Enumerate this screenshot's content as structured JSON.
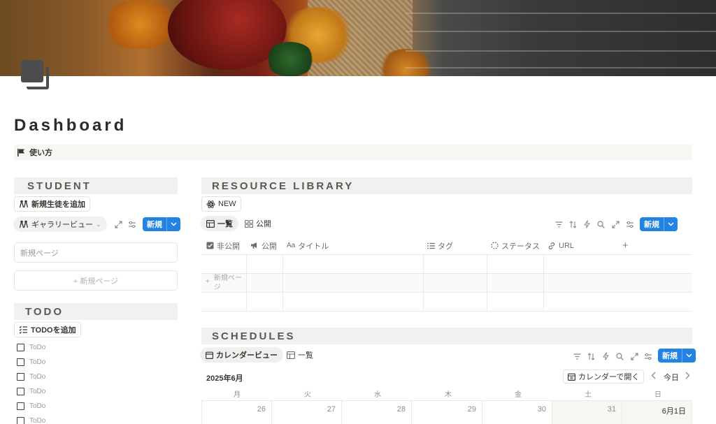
{
  "page": {
    "title": "Dashboard",
    "callout": "使い方"
  },
  "student": {
    "header": "STUDENT",
    "add_button": "新規生徒を追加",
    "view_label": "ギャラリービュー",
    "new_label": "新規",
    "card_title": "新規ページ",
    "add_card": "+ 新規ページ"
  },
  "todo": {
    "header": "TODO",
    "add_button": "TODOを追加",
    "items": [
      "ToDo",
      "ToDo",
      "ToDo",
      "ToDo",
      "ToDo",
      "ToDo"
    ]
  },
  "resource": {
    "header": "RESOURCE LIBRARY",
    "new_page_button": "NEW",
    "tabs": [
      "一覧",
      "公開"
    ],
    "new_label": "新規",
    "columns": [
      "非公開",
      "公開",
      "タイトル",
      "タグ",
      "ステータス",
      "URL"
    ],
    "add_row": "新規ページ"
  },
  "schedules": {
    "header": "SCHEDULES",
    "tabs": [
      "カレンダービュー",
      "一覧"
    ],
    "new_label": "新規",
    "month": "2025年6月",
    "open_calendar": "カレンダーで開く",
    "today": "今日",
    "weekdays": [
      "月",
      "火",
      "水",
      "木",
      "金",
      "土",
      "日"
    ],
    "dates": [
      "26",
      "27",
      "28",
      "29",
      "30",
      "31",
      "6月1日"
    ]
  },
  "colors": {
    "accent": "#2383e2",
    "section_bg": "#f1f1ef",
    "text": "#37352f"
  },
  "icons": [
    "flag-icon",
    "people-icon",
    "table-icon",
    "gallery-icon",
    "filter-icon",
    "sort-icon",
    "bolt-icon",
    "search-icon",
    "expand-icon",
    "settings-icon",
    "chevron-down-icon",
    "checklist-icon",
    "calendar-icon",
    "chevron-left-icon",
    "chevron-right-icon",
    "plus-icon",
    "link-icon",
    "atom-icon"
  ]
}
